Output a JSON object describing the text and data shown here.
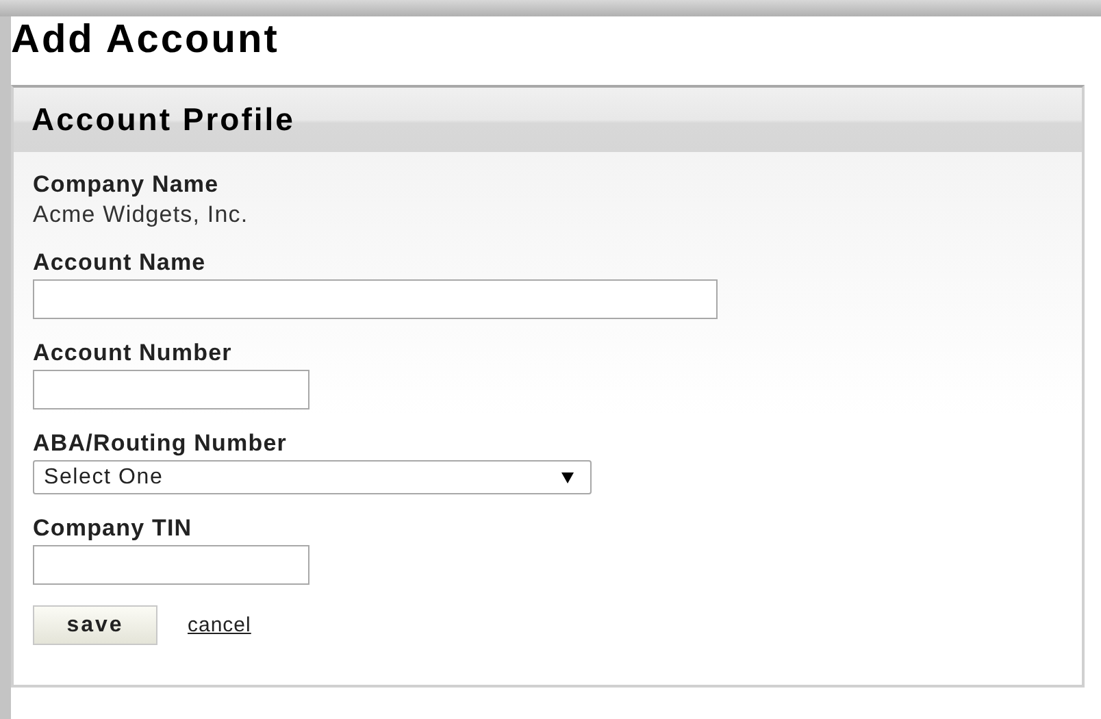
{
  "page": {
    "title": "Add Account"
  },
  "panel": {
    "title": "Account Profile"
  },
  "fields": [
    {
      "kind": "text",
      "label": "Company Name",
      "value": "Acme Widgets, Inc."
    },
    {
      "kind": "wide-input",
      "label": "Account Name"
    },
    {
      "kind": "input",
      "label": "Account Number"
    },
    {
      "kind": "select",
      "label": "ABA/Routing Number",
      "value": "Select One"
    },
    {
      "kind": "input",
      "label": "Company TIN"
    }
  ],
  "actions": {
    "save": "save",
    "cancel": "cancel"
  }
}
